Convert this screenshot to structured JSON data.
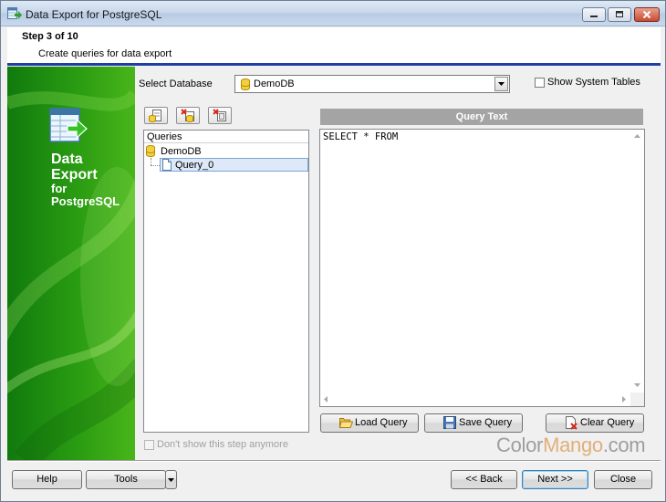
{
  "window": {
    "title": "Data Export for PostgreSQL",
    "controls": [
      "minimize-icon",
      "maximize-icon",
      "close-icon"
    ]
  },
  "header": {
    "step": "Step 3 of 10",
    "description": "Create queries for data export"
  },
  "banner": {
    "line1": "Data",
    "line2": "Export",
    "line3": "for",
    "line4": "PostgreSQL",
    "color": "#2a9c12"
  },
  "database": {
    "label": "Select Database",
    "selected": "DemoDB",
    "show_system_tables_label": "Show System Tables",
    "show_system_tables": false
  },
  "toolbar": {
    "buttons": [
      "add-query-icon",
      "delete-query-icon",
      "delete-all-queries-icon"
    ]
  },
  "tree": {
    "header": "Queries",
    "root": "DemoDB",
    "items": [
      "Query_0"
    ]
  },
  "query": {
    "header": "Query Text",
    "text": "SELECT * FROM"
  },
  "query_buttons": {
    "load": "Load Query",
    "save": "Save Query",
    "clear": "Clear Query"
  },
  "dont_show": {
    "label": "Don't show this step anymore",
    "checked": false
  },
  "footer": {
    "help": "Help",
    "tools": "Tools",
    "back": "<< Back",
    "next": "Next >>",
    "close": "Close"
  },
  "watermark": {
    "color_part": "Color",
    "mango_part": "Mango",
    "suffix": ".com"
  }
}
